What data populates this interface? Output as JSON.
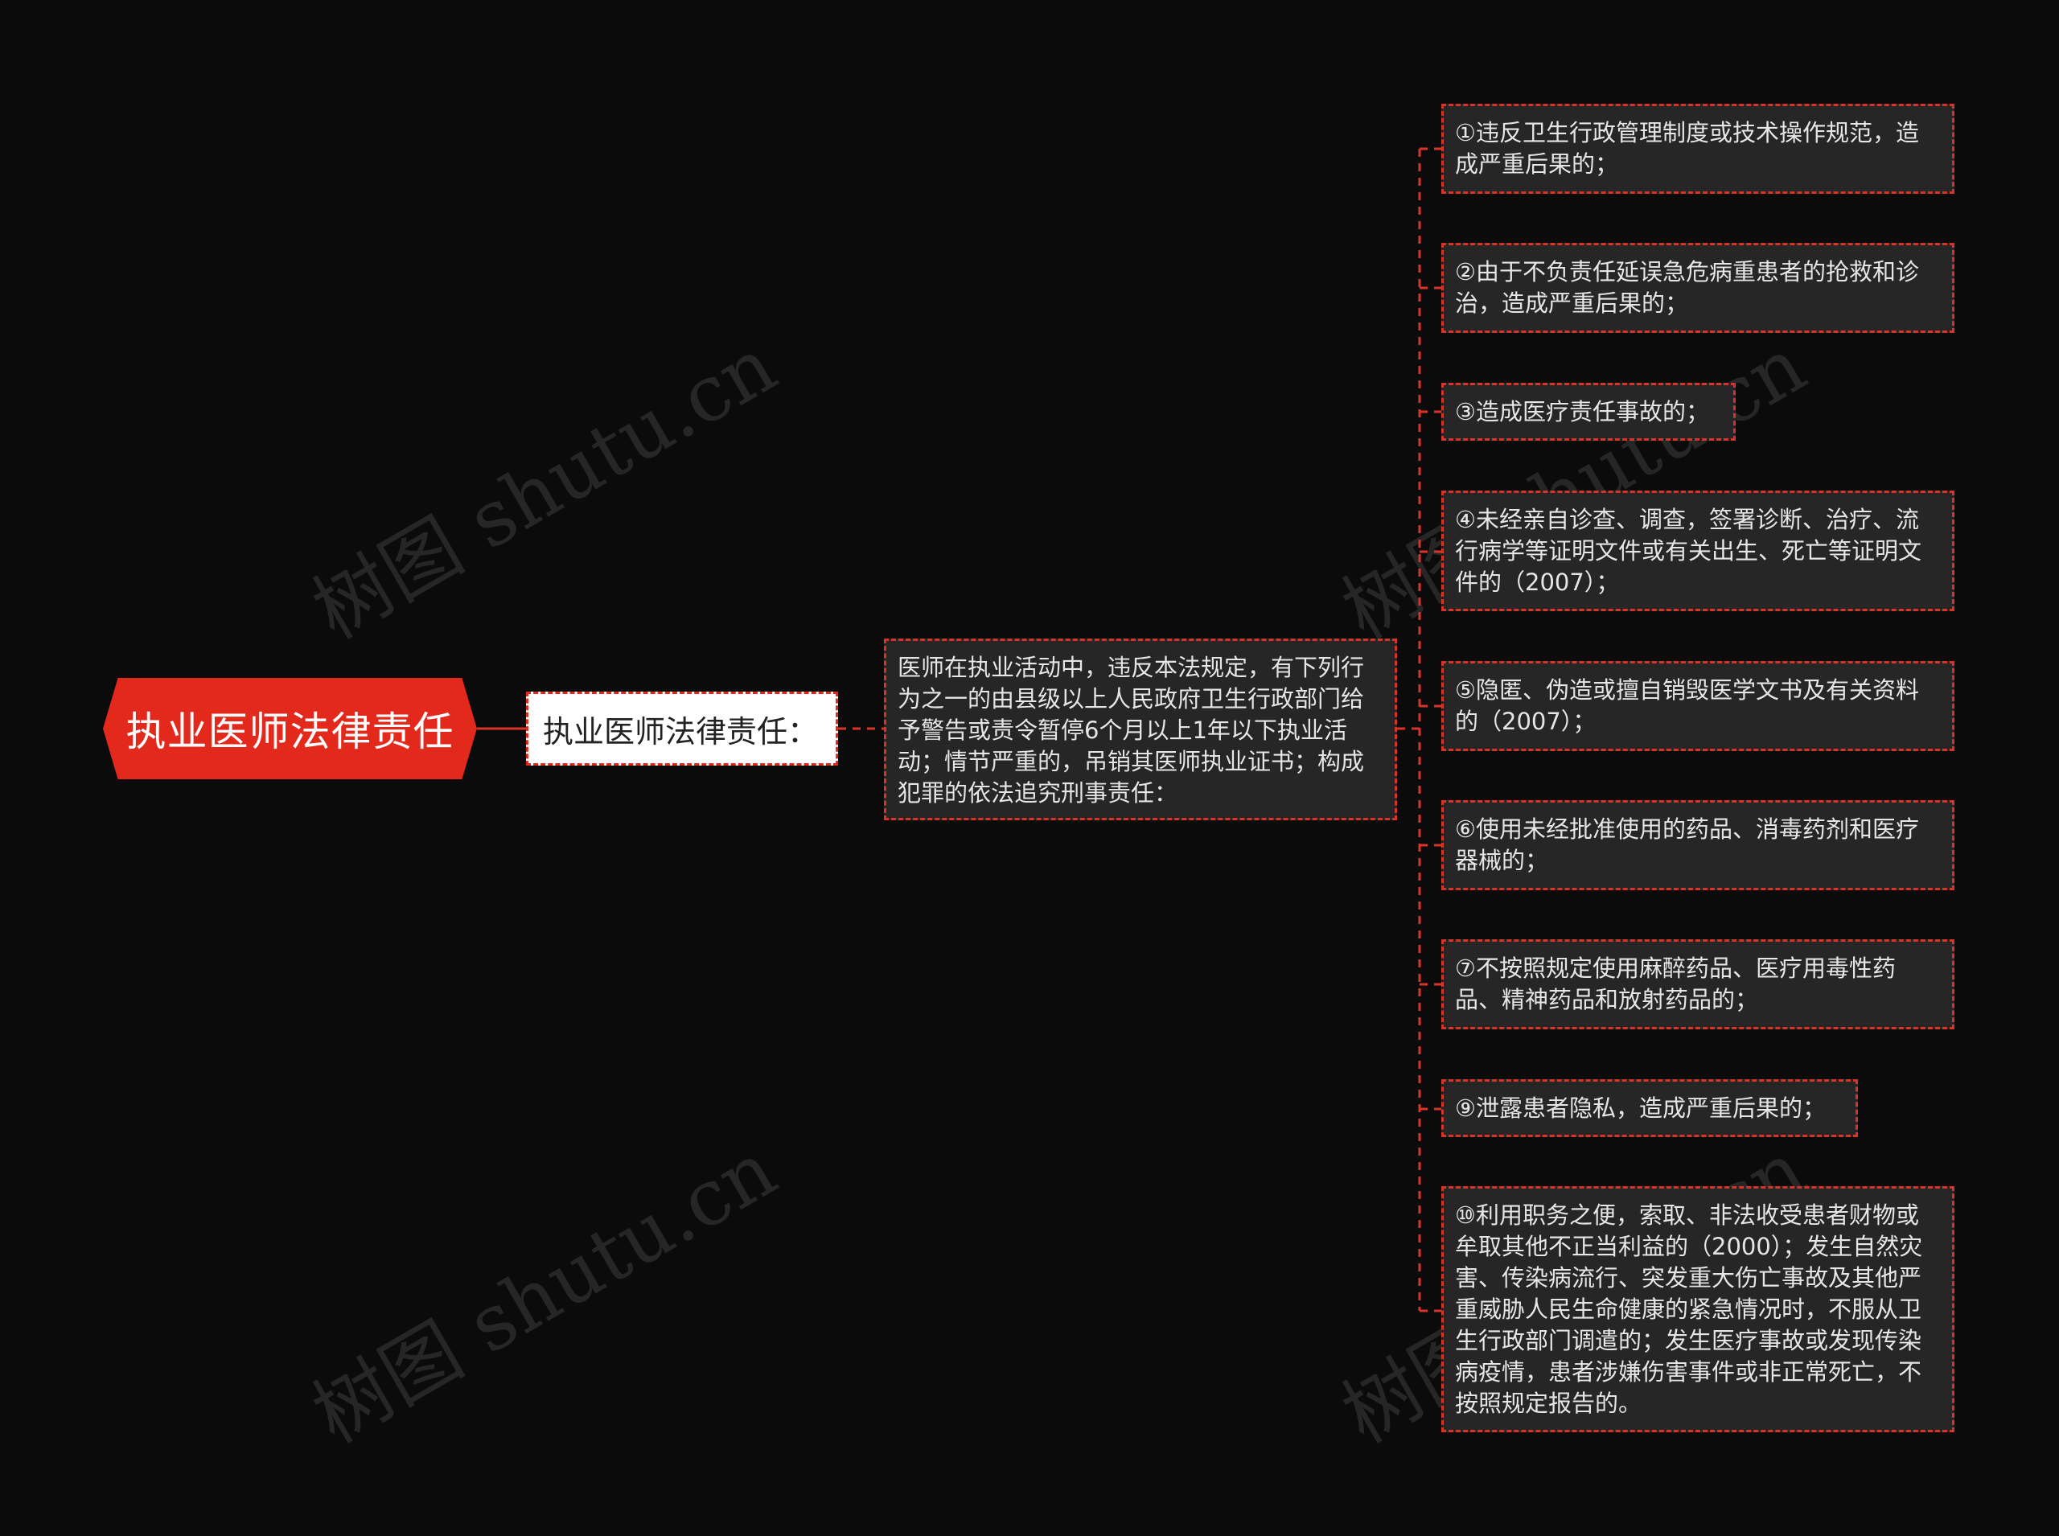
{
  "watermark": "树图 shutu.cn",
  "root": {
    "label": "执业医师法律责任"
  },
  "level1": {
    "label": "执业医师法律责任："
  },
  "level2": {
    "text": "医师在执业活动中，违反本法规定，有下列行为之一的由县级以上人民政府卫生行政部门给予警告或责令暂停6个月以上1年以下执业活动；情节严重的，吊销其医师执业证书；构成犯罪的依法追究刑事责任："
  },
  "leaves": [
    {
      "text": "①违反卫生行政管理制度或技术操作规范，造成严重后果的；"
    },
    {
      "text": "②由于不负责任延误急危病重患者的抢救和诊治，造成严重后果的；"
    },
    {
      "text": "③造成医疗责任事故的；"
    },
    {
      "text": "④未经亲自诊查、调查，签署诊断、治疗、流行病学等证明文件或有关出生、死亡等证明文件的（2007）；"
    },
    {
      "text": "⑤隐匿、伪造或擅自销毁医学文书及有关资料的（2007）；"
    },
    {
      "text": "⑥使用未经批准使用的药品、消毒药剂和医疗器械的；"
    },
    {
      "text": "⑦不按照规定使用麻醉药品、医疗用毒性药品、精神药品和放射药品的；"
    },
    {
      "text": "⑨泄露患者隐私，造成严重后果的；"
    },
    {
      "text": "⑩利用职务之便，索取、非法收受患者财物或牟取其他不正当利益的（2000）；发生自然灾害、传染病流行、突发重大伤亡事故及其他严重威胁人民生命健康的紧急情况时，不服从卫生行政部门调遣的；发生医疗事故或发现传染病疫情，患者涉嫌伤害事件或非正常死亡，不按照规定报告的。"
    }
  ],
  "colors": {
    "background": "#0b0b0b",
    "accent": "#e2291c",
    "node_fill": "#262626",
    "connector": "#d8342a"
  }
}
